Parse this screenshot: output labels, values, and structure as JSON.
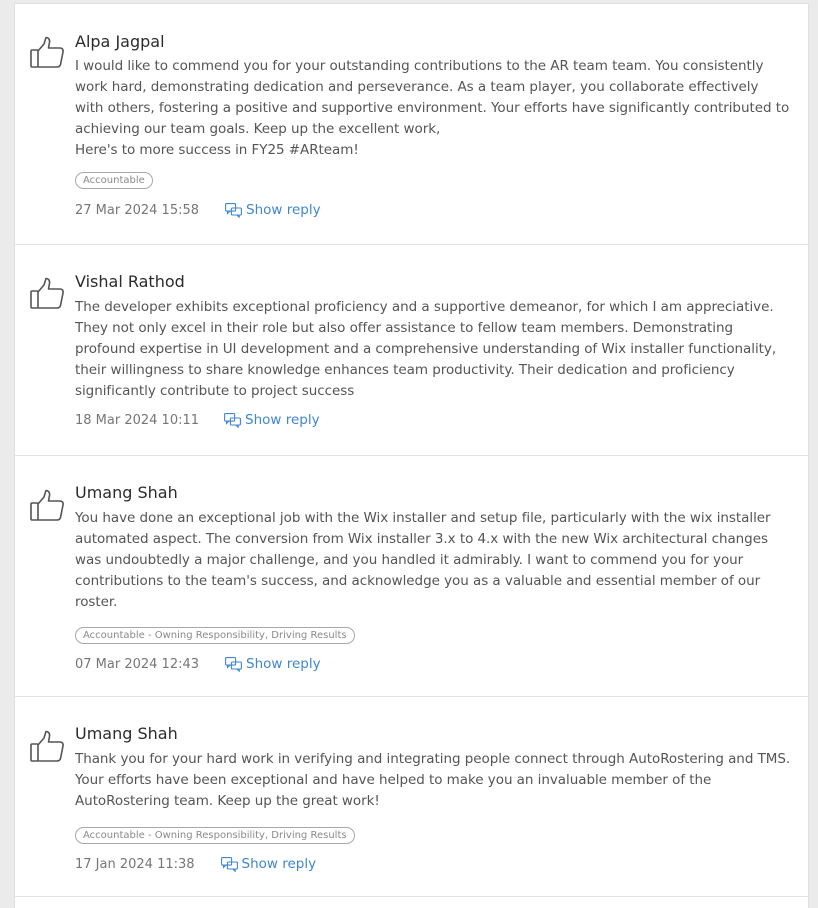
{
  "feed": {
    "items": [
      {
        "name": "Alpa Jagpal",
        "message": "I would like to commend you for your outstanding contributions to the AR team team. You consistently work hard, demonstrating dedication and perseverance. As a team player, you collaborate effectively with others, fostering a positive and supportive environment. Your efforts have significantly contributed to achieving our team goals. Keep up the excellent work,\nHere's to more success in FY25 #ARteam!",
        "tag": "Accountable",
        "date": "27 Mar 2024 15:58",
        "reply_label": "Show reply"
      },
      {
        "name": "Vishal Rathod",
        "message": "The developer exhibits exceptional proficiency and a supportive demeanor, for which I am appreciative. They not only excel in their role but also offer assistance to fellow team members. Demonstrating profound expertise in UI development and a comprehensive understanding of Wix installer functionality, their willingness to share knowledge enhances team productivity. Their dedication and proficiency significantly contribute to project success",
        "tag": "",
        "date": "18 Mar 2024 10:11",
        "reply_label": "Show reply"
      },
      {
        "name": "Umang Shah",
        "message": "You have done an exceptional job with the Wix installer and setup file, particularly with the wix installer automated aspect. The conversion from Wix installer 3.x to 4.x with the new Wix architectural changes was undoubtedly a major challenge, and you handled it admirably. I want to commend you for your contributions to the team's success, and acknowledge you as a valuable and essential member of our roster.",
        "tag": "Accountable - Owning Responsibility, Driving Results",
        "date": "07 Mar 2024 12:43",
        "reply_label": "Show reply"
      },
      {
        "name": "Umang Shah",
        "message": "Thank you for your hard work in verifying and integrating people connect through AutoRostering and TMS. Your efforts have been exceptional and have helped to make you an invaluable member of the AutoRostering team. Keep up the great work!",
        "tag": "Accountable - Owning Responsibility, Driving Results",
        "date": "17 Jan 2024 11:38",
        "reply_label": "Show reply"
      }
    ]
  },
  "colors": {
    "link": "#3f87cf",
    "text": "#555555",
    "name": "#2b2b2b",
    "background": "#ebebeb",
    "card": "#ffffff"
  },
  "icons": {
    "like": "thumbs-up-icon",
    "reply": "reply-icon"
  }
}
